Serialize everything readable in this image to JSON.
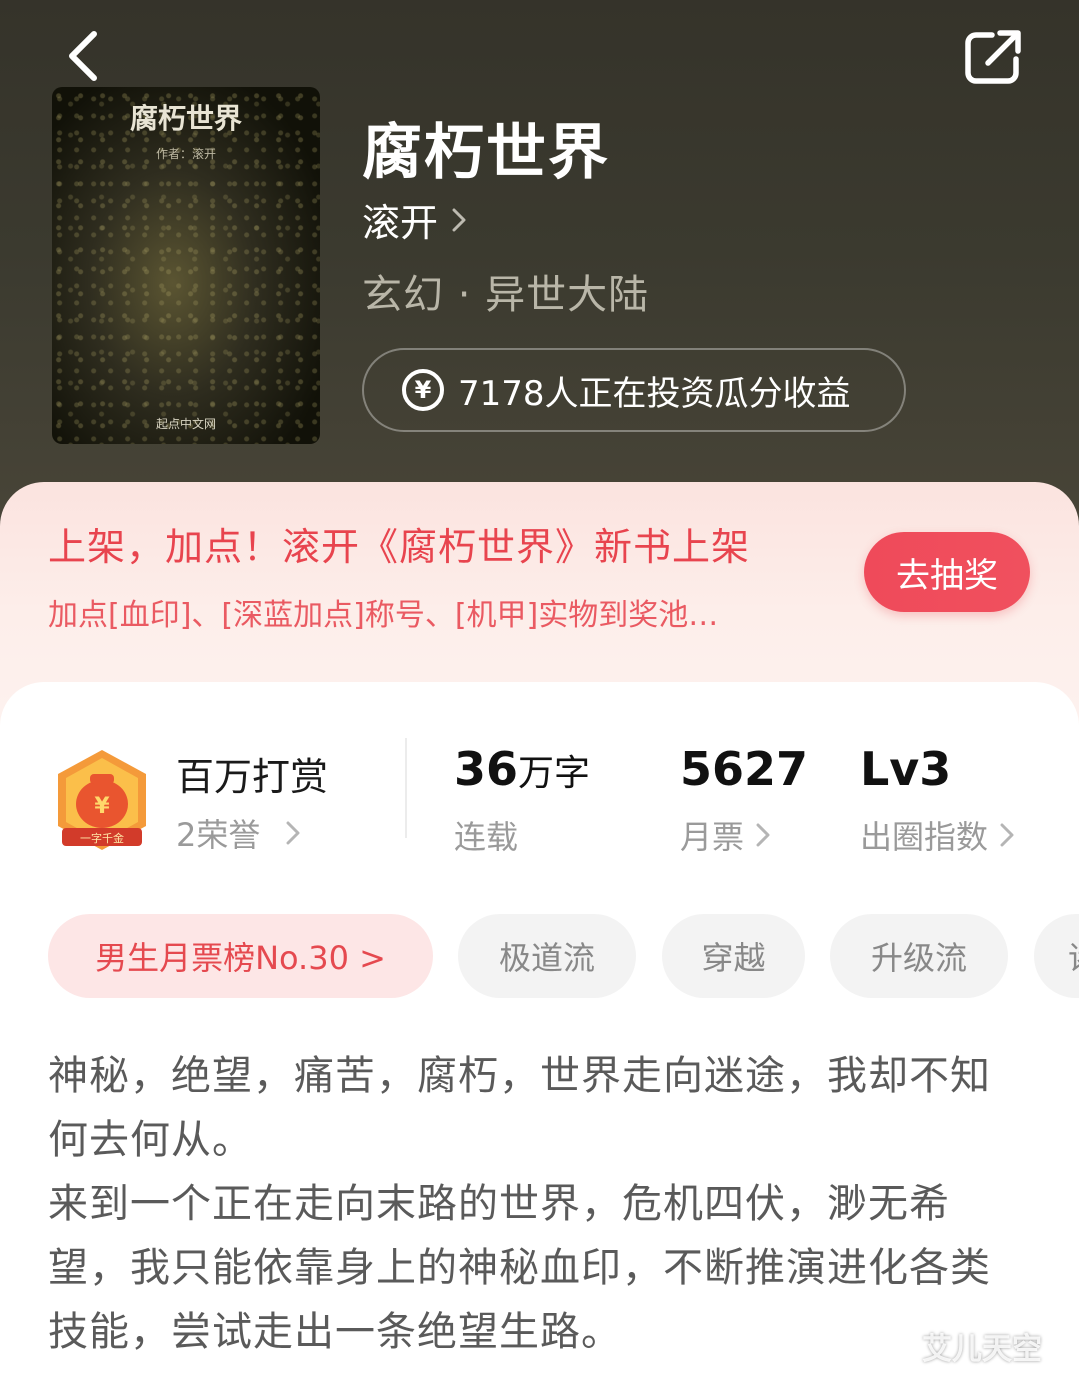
{
  "book": {
    "title": "腐朽世界",
    "author": "滚开",
    "genre": "玄幻 · 异世大陆",
    "cover": {
      "title": "腐朽世界",
      "author_line": "作者：滚开",
      "publisher": "起点中文网"
    }
  },
  "header": {
    "back_icon": "chevron-left-icon",
    "share_icon": "share-icon"
  },
  "invest": {
    "icon": "yen-icon",
    "icon_glyph": "¥",
    "text": "7178人正在投资瓜分收益"
  },
  "promo": {
    "title": "上架，加点！滚开《腐朽世界》新书上架",
    "subtitle": "加点[血印]、[深蓝加点]称号、[机甲]实物到奖池…",
    "button_label": "去抽奖",
    "color": "#e8444e"
  },
  "stats": {
    "reward": {
      "title": "百万打赏",
      "sub": "2荣誉",
      "badge_text": "一字千金"
    },
    "words": {
      "value": "36",
      "unit": "万字",
      "label": "连载"
    },
    "monthly_votes": {
      "value": "5627",
      "label": "月票"
    },
    "popularity": {
      "value": "Lv3",
      "label": "出圈指数"
    }
  },
  "tags": [
    {
      "label": "男生月票榜No.30 >"
    },
    {
      "label": "极道流"
    },
    {
      "label": "穿越"
    },
    {
      "label": "升级流"
    },
    {
      "label": "诸"
    }
  ],
  "description": [
    "神秘，绝望，痛苦，腐朽，世界走向迷途，我却不知何去何从。",
    "来到一个正在走向末路的世界，危机四伏，渺无希望，我只能依靠身上的神秘血印，不断推演进化各类技能，尝试走出一条绝望生路。"
  ],
  "watermark": "艾儿天空"
}
